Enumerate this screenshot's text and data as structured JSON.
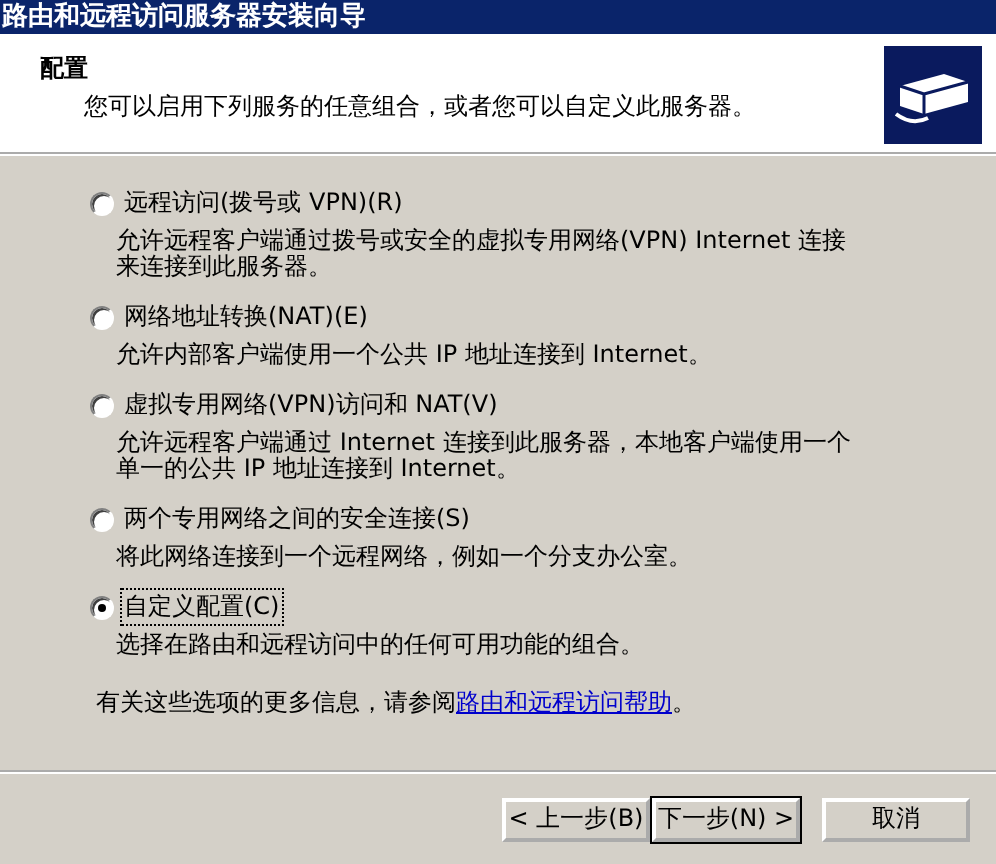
{
  "window": {
    "title": "路由和远程访问服务器安装向导"
  },
  "header": {
    "title": "配置",
    "subtitle": "您可以启用下列服务的任意组合，或者您可以自定义此服务器。"
  },
  "options": [
    {
      "label": "远程访问(拨号或 VPN)(R)",
      "description": "允许远程客户端通过拨号或安全的虚拟专用网络(VPN) Internet 连接来连接到此服务器。",
      "selected": false
    },
    {
      "label": "网络地址转换(NAT)(E)",
      "description": "允许内部客户端使用一个公共 IP 地址连接到 Internet。",
      "selected": false
    },
    {
      "label": "虚拟专用网络(VPN)访问和 NAT(V)",
      "description": "允许远程客户端通过 Internet 连接到此服务器，本地客户端使用一个单一的公共 IP 地址连接到 Internet。",
      "selected": false
    },
    {
      "label": "两个专用网络之间的安全连接(S)",
      "description": "将此网络连接到一个远程网络，例如一个分支办公室。",
      "selected": false
    },
    {
      "label": "自定义配置(C)",
      "description": "选择在路由和远程访问中的任何可用功能的组合。",
      "selected": true
    }
  ],
  "help": {
    "text": "有关这些选项的更多信息，请参阅",
    "link": "路由和远程访问帮助",
    "end": "。"
  },
  "buttons": [
    {
      "label": "< 上一步(B)",
      "default": false
    },
    {
      "label": "下一步(N) >",
      "default": true
    },
    {
      "label": "取消",
      "default": false
    }
  ]
}
